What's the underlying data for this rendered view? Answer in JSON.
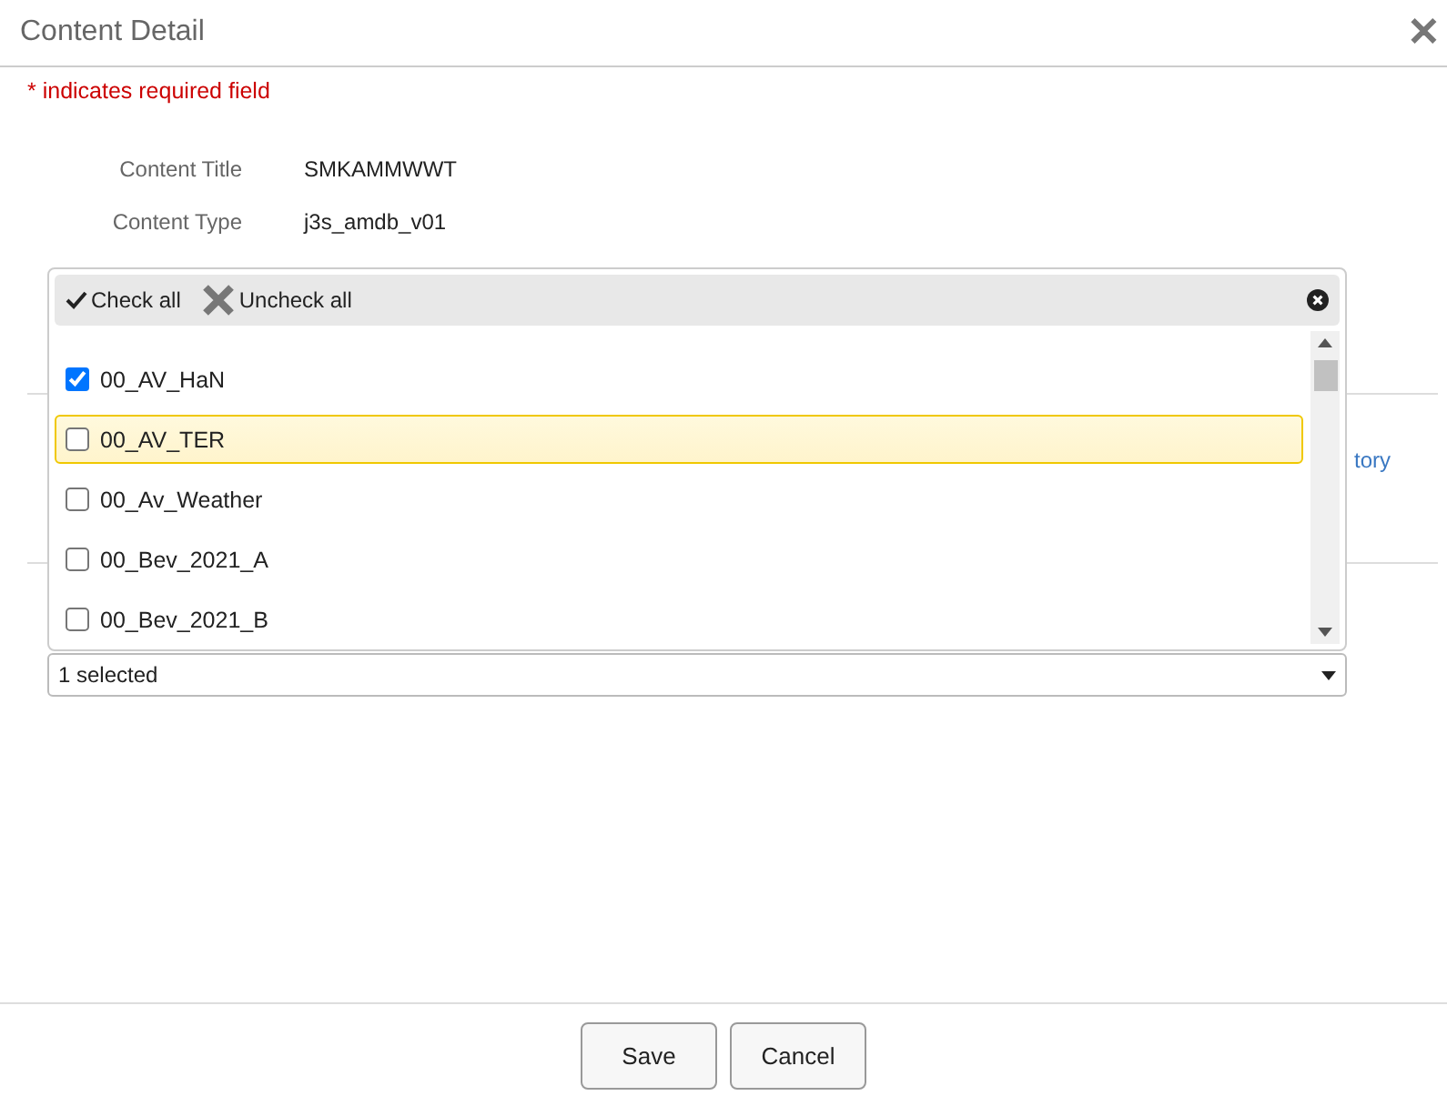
{
  "dialog": {
    "title": "Content Detail",
    "close": "✕"
  },
  "required_note": "* indicates required field",
  "fields": [
    {
      "label": "Content Title",
      "value": "SMKAMMWWT"
    },
    {
      "label": "Content Type",
      "value": "j3s_amdb_v01"
    }
  ],
  "side_link": "tory",
  "multiselect": {
    "check_all": "Check all",
    "uncheck_all": "Uncheck all",
    "summary": "1 selected",
    "options": [
      {
        "label": "00_AV_HaN",
        "checked": true,
        "selected": false
      },
      {
        "label": "00_AV_TER",
        "checked": false,
        "selected": true
      },
      {
        "label": "00_Av_Weather",
        "checked": false,
        "selected": false
      },
      {
        "label": "00_Bev_2021_A",
        "checked": false,
        "selected": false
      },
      {
        "label": "00_Bev_2021_B",
        "checked": false,
        "selected": false
      }
    ]
  },
  "buttons": [
    "Save",
    "Cancel"
  ]
}
